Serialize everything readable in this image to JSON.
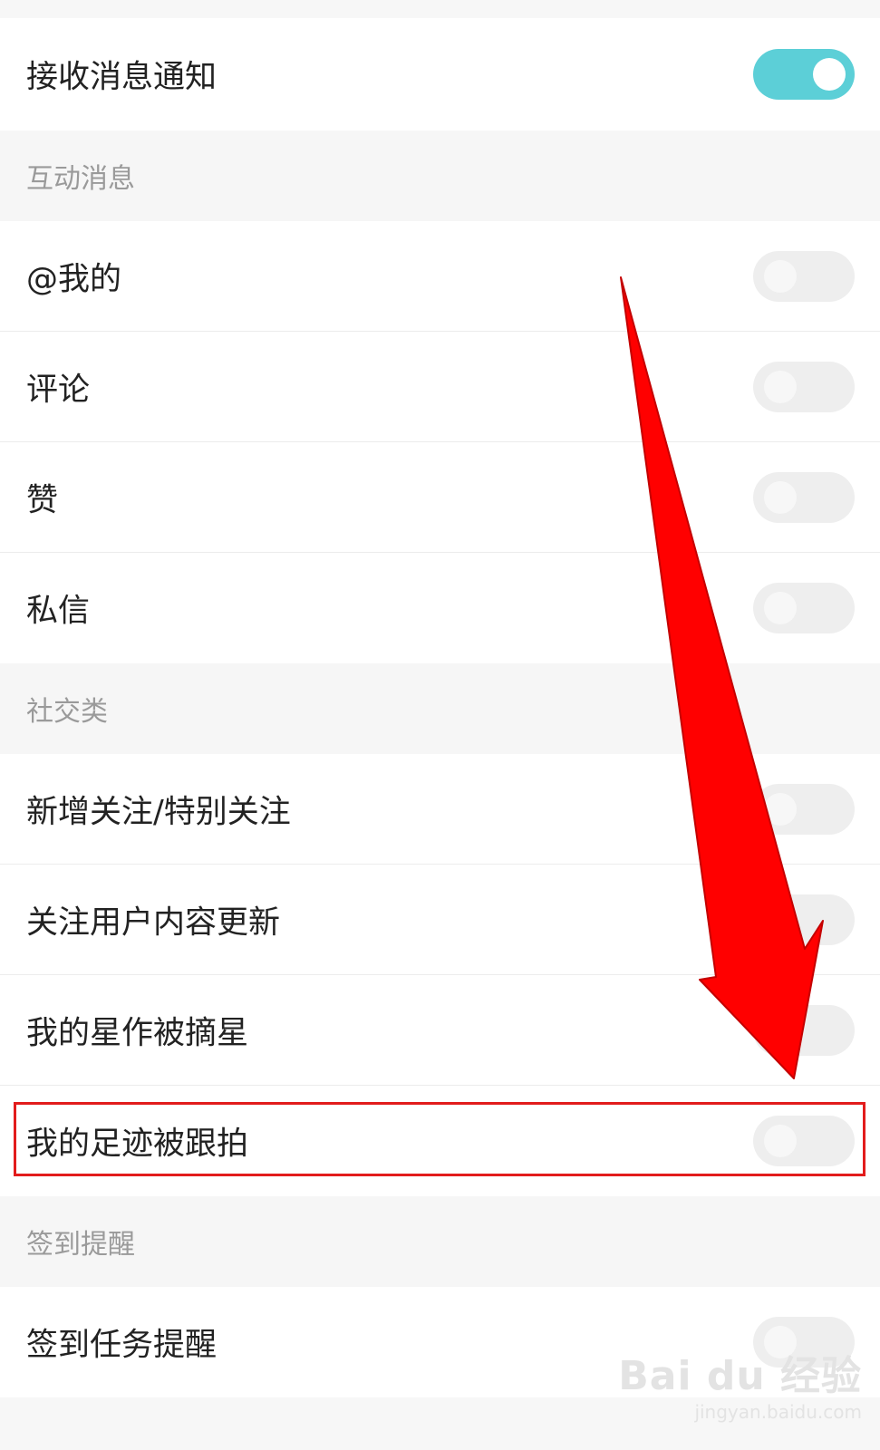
{
  "settings": {
    "master": {
      "label": "接收消息通知",
      "on": true
    },
    "sections": [
      {
        "title": "互动消息",
        "items": [
          {
            "label": "@我的",
            "on": false
          },
          {
            "label": "评论",
            "on": false
          },
          {
            "label": "赞",
            "on": false
          },
          {
            "label": "私信",
            "on": false
          }
        ]
      },
      {
        "title": "社交类",
        "items": [
          {
            "label": "新增关注/特别关注",
            "on": false
          },
          {
            "label": "关注用户内容更新",
            "on": false
          },
          {
            "label": "我的星作被摘星",
            "on": false
          },
          {
            "label": "我的足迹被跟拍",
            "on": false
          }
        ]
      },
      {
        "title": "签到提醒",
        "items": [
          {
            "label": "签到任务提醒",
            "on": false
          }
        ]
      }
    ]
  },
  "annotation": {
    "arrow_color": "#ff0000",
    "highlight_color": "#e21c1c"
  },
  "colors": {
    "toggle_on": "#5ccfd7",
    "toggle_off": "#eeeeee"
  },
  "watermark": {
    "logo": "Bai du 经验",
    "url": "jingyan.baidu.com"
  }
}
